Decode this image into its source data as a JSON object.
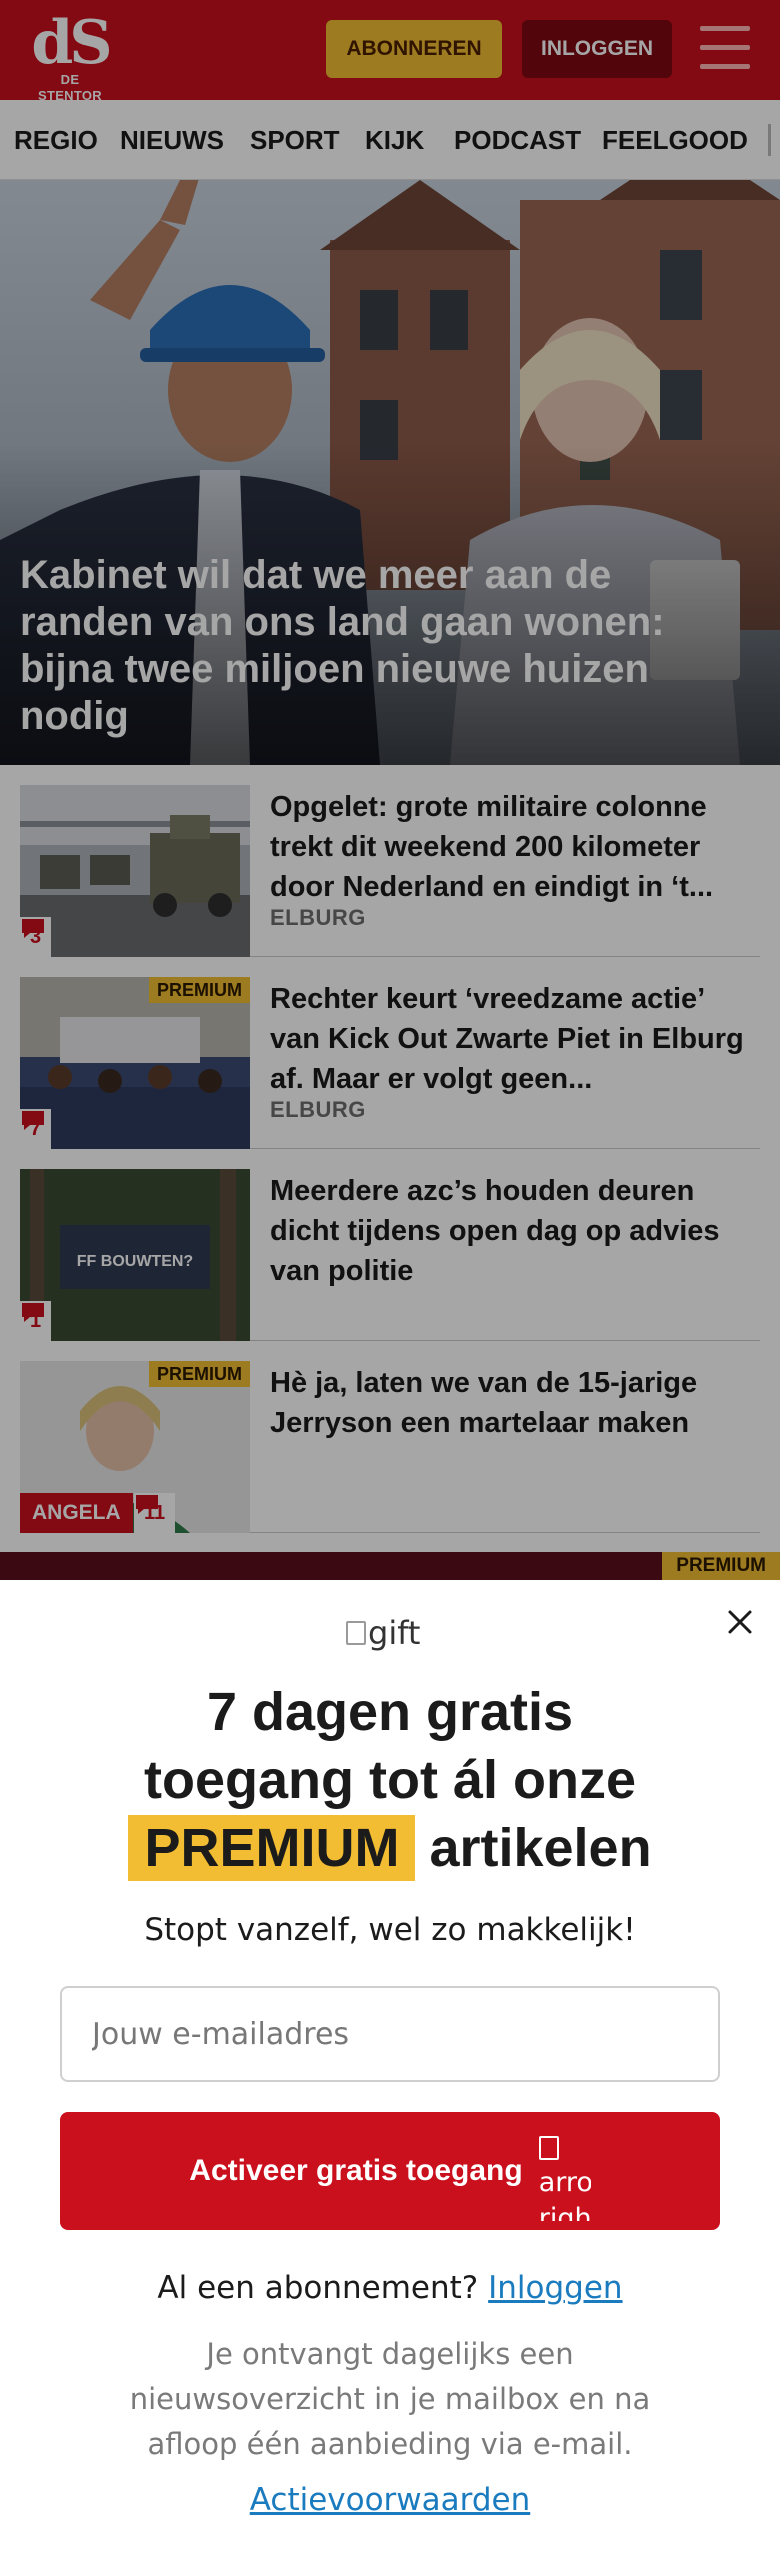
{
  "header": {
    "logo_mark": "dS",
    "logo_name": "DE STENTOR",
    "subscribe_label": "ABONNEREN",
    "login_label": "INLOGGEN",
    "menu_icon": "hamburger-icon",
    "brand_color": "#ca0f1d"
  },
  "nav": {
    "items": [
      {
        "label": "REGIO"
      },
      {
        "label": "NIEUWS"
      },
      {
        "label": "SPORT"
      },
      {
        "label": "KIJK"
      },
      {
        "label": "PODCAST"
      },
      {
        "label": "FEELGOOD"
      }
    ]
  },
  "hero": {
    "title": "Kabinet wil dat we meer aan de randen van ons land gaan wonen: bijna twee miljoen nieuwe huizen nodig"
  },
  "articles": [
    {
      "headline": "Opgelet: grote militaire colonne trekt dit weekend 200 kilometer door Nederland en eindigt in ‘t...",
      "label": "ELBURG",
      "comments": "3",
      "premium": ""
    },
    {
      "headline": "Rechter keurt ‘vreedzame actie’ van Kick Out Zwarte Piet in Elburg af. Maar er volgt geen...",
      "label": "ELBURG",
      "comments": "7",
      "premium": "PREMIUM"
    },
    {
      "headline": "Meerdere azc’s houden deuren dicht tijdens open dag op advies van politie",
      "label": "",
      "comments": "1",
      "premium": "",
      "thumb_sign_text": "FF BOUWTEN?"
    },
    {
      "headline": "Hè ja, laten we van de 15-jarige Jerryson een martelaar maken",
      "label": "",
      "comments": "11",
      "premium": "PREMIUM",
      "author": "ANGELA"
    }
  ],
  "strip": {
    "premium": "PREMIUM"
  },
  "modal": {
    "gift_alt": "gift",
    "title_line1": "7 dagen gratis",
    "title_line2": "toegang tot ál onze",
    "title_premium": "PREMIUM",
    "title_rest": "artikelen",
    "subtitle": "Stopt vanzelf, wel zo makkelijk!",
    "email_placeholder": "Jouw e-mailadres",
    "email_value": "",
    "activate_label": "Activeer gratis toegang",
    "arrow_alt": "arrow right",
    "login_question": "Al een abonnement?",
    "login_link": "Inloggen",
    "disclaimer": "Je ontvangt dagelijks een nieuwsoverzicht in je mailbox en na afloop één aanbieding via e-mail.",
    "terms_link": "Actievoorwaarden",
    "premium_color": "#f2bd33",
    "link_color": "#1a7bbf"
  }
}
